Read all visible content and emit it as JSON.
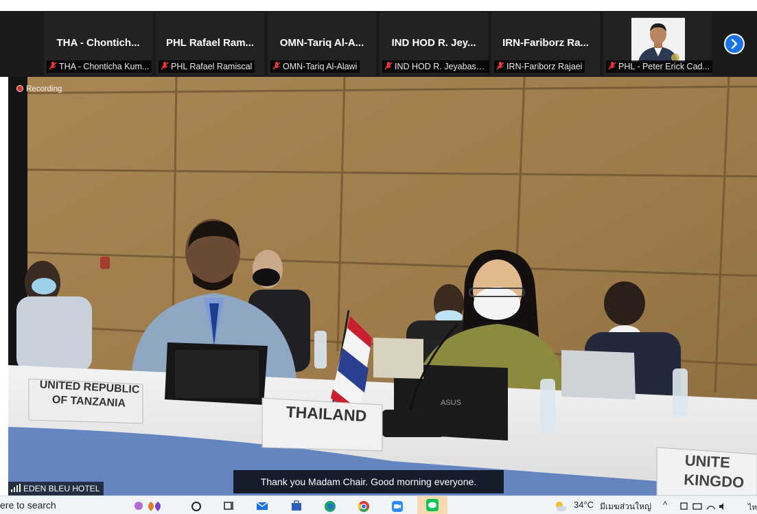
{
  "participants": [
    {
      "tile_name": "THA - Chontich...",
      "label": "THA - Chonticha Kum..."
    },
    {
      "tile_name": "PHL Rafael Ram...",
      "label": "PHL Rafael Ramiscal"
    },
    {
      "tile_name": "OMN-Tariq Al-A...",
      "label": "OMN-Tariq Al-Alawi"
    },
    {
      "tile_name": "IND HOD R. Jey...",
      "label": "IND HOD R. Jeyabask..."
    },
    {
      "tile_name": "IRN-Fariborz Ra...",
      "label": "IRN-Fariborz Rajaei"
    },
    {
      "tile_name": "",
      "label": "PHL - Peter Erick Cad..."
    }
  ],
  "recording_label": "Recording",
  "caption": "Thank you Madam Chair. Good morning everyone.",
  "video_source": "EDEN BLEU HOTEL",
  "placards": {
    "tanzania_line1": "UNITED REPUBLIC",
    "tanzania_line2": "OF TANZANIA",
    "thailand": "THAILAND",
    "uk_line1": "UNITE",
    "uk_line2": "KINGDO"
  },
  "laptop_brand": "ASUS",
  "taskbar": {
    "search_text": "ere to search",
    "weather": "34°C",
    "weather_desc": "มีเมฆส่วนใหญ่",
    "lang": "ไท"
  },
  "colors": {
    "strip_bg": "#1a1a1a",
    "accent_blue": "#1a73e8",
    "muted_red": "#e53935",
    "wall": "#a4824f"
  }
}
